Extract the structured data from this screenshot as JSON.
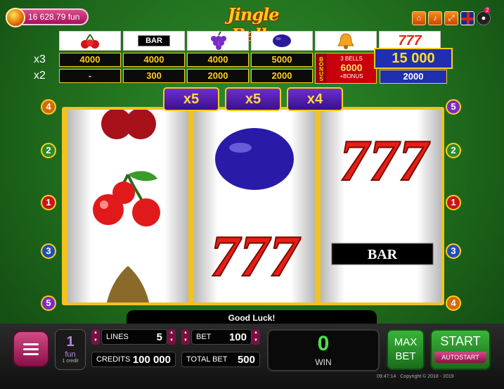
{
  "balance": {
    "text": "16 628.79 fun"
  },
  "title": "Jingle Bells",
  "notification_count": "2",
  "paytable": {
    "row_labels": [
      "x3",
      "x2"
    ],
    "columns": [
      {
        "symbol": "cherry-icon",
        "x3": "4000",
        "x2": "-"
      },
      {
        "symbol": "BAR",
        "x3": "4000",
        "x2": "300"
      },
      {
        "symbol": "grape-icon",
        "x3": "4000",
        "x2": "2000"
      },
      {
        "symbol": "plum-icon",
        "x3": "5000",
        "x2": "2000"
      }
    ],
    "bonus": {
      "word": "BONUS",
      "label": "3 BELLS",
      "value": "6000",
      "suffix": "+BONUS"
    },
    "sevens": {
      "x3": "15 000",
      "x2": "2000"
    }
  },
  "multipliers": [
    "x5",
    "x5",
    "x4"
  ],
  "line_numbers": {
    "left": [
      "4",
      "2",
      "1",
      "3",
      "5"
    ],
    "right": [
      "5",
      "2",
      "1",
      "3",
      "4"
    ]
  },
  "reels": [
    [
      "cherry-icon",
      "cherry-icon",
      "pear-icon"
    ],
    [
      "plum-icon",
      "seven-icon",
      ""
    ],
    [
      "seven-icon",
      "",
      "bar-icon"
    ]
  ],
  "reel_bar_text": "BAR",
  "reel_seven_text": "777",
  "message": "Good Luck!",
  "controls": {
    "denomination": {
      "value": "1",
      "unit": "fun",
      "credit_text": "1 credit"
    },
    "lines": {
      "label": "LINES",
      "value": "5"
    },
    "bet": {
      "label": "BET",
      "value": "100"
    },
    "credits": {
      "label": "CREDITS",
      "value": "100 000"
    },
    "total_bet": {
      "label": "TOTAL BET",
      "value": "500"
    },
    "win": {
      "value": "0",
      "label": "WIN"
    },
    "max_bet": {
      "line1": "MAX",
      "line2": "BET"
    },
    "start": {
      "label": "START",
      "autostart": "AUTOSTART"
    }
  },
  "footer": {
    "time": "09:47:14",
    "copyright": "Copyright © 2018 - 2019"
  },
  "colors": {
    "felt": "#1f6b1c",
    "gold": "#f2c21e",
    "purple": "#5a1fb0",
    "pink": "#c2185b"
  }
}
